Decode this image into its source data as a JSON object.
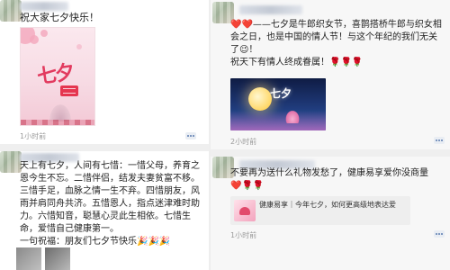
{
  "left": {
    "post1": {
      "text": "祝大家七夕快乐！",
      "image_title": "七夕",
      "time": "1小时前"
    },
    "post2": {
      "text": "天上有七夕，人间有七惜：一惜父母，养育之恩今生不忘。二惜伴侣，结发夫妻贫富不移。三惜手足，血脉之情一生不弃。四惜朋友，风雨并肩同舟共济。五惜恩人，指点迷津难时助力。六惜知音，聪慧心灵此生相依。七惜生命，爱惜自己健康第一。\n一句祝福：朋友们七夕节快乐🎉🎉🎉",
      "time": ""
    }
  },
  "right": {
    "post1": {
      "text": "❤️❤️——七夕是牛郎织女节，喜鹊搭桥牛郎与织女相会之日，也是中国的情人节！与这个年纪的我们无关了😉！\n祝天下有情人终成眷属！🌹🌹🌹",
      "image_title": "七夕",
      "time": "2小时前"
    },
    "post2": {
      "text": "不要再为送什么礼物发愁了，健康易享爱你没商量❤️🌹🌹",
      "link_title": "健康易享｜今年七夕，如何更高级地表达爱",
      "time": "1小时前"
    }
  }
}
